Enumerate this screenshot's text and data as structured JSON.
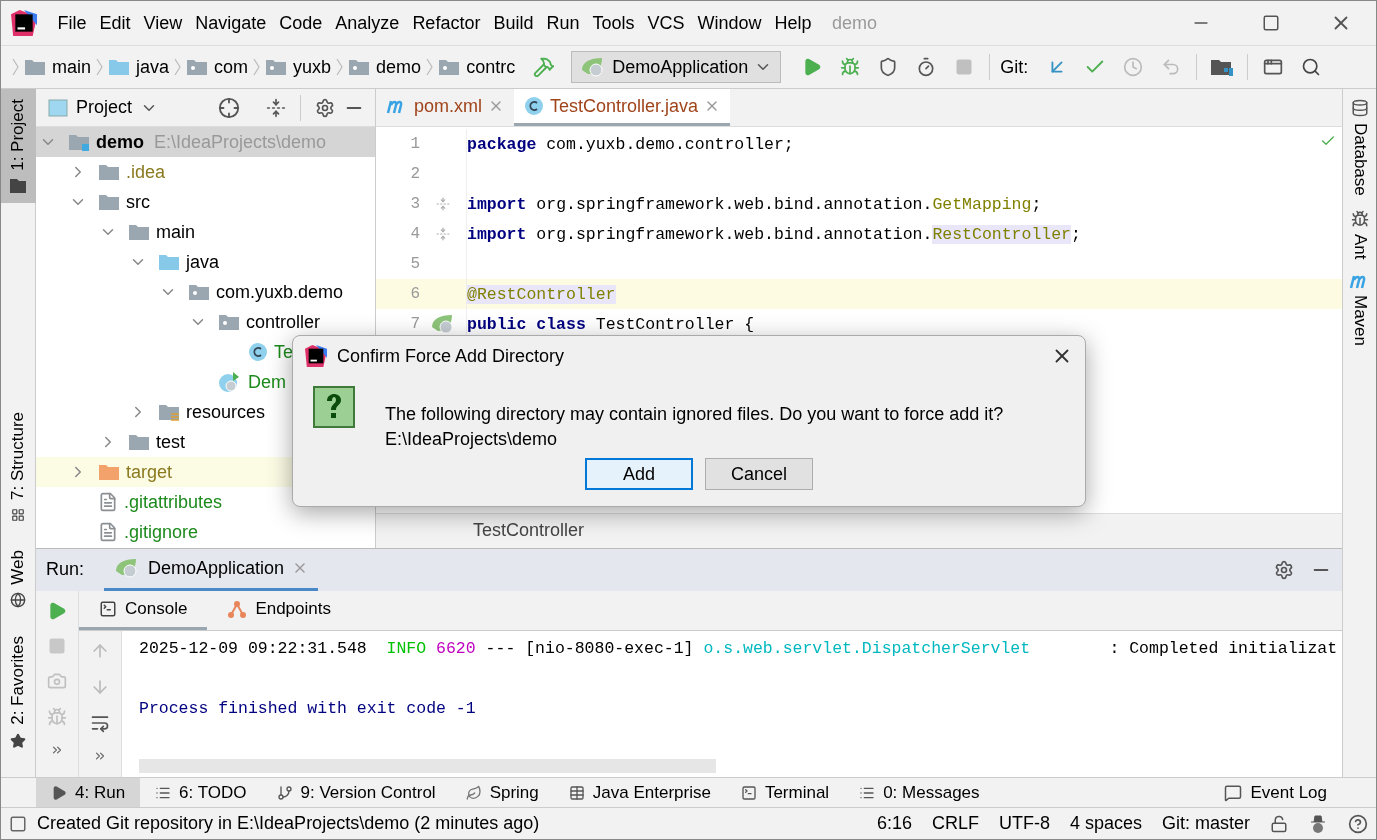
{
  "menu": {
    "items": [
      "File",
      "Edit",
      "View",
      "Navigate",
      "Code",
      "Analyze",
      "Refactor",
      "Build",
      "Run",
      "Tools",
      "VCS",
      "Window",
      "Help"
    ],
    "project_title": "demo"
  },
  "navbar": {
    "breadcrumbs": [
      {
        "label": "main",
        "kind": "folder"
      },
      {
        "label": "java",
        "kind": "source-folder"
      },
      {
        "label": "com",
        "kind": "package"
      },
      {
        "label": "yuxb",
        "kind": "package"
      },
      {
        "label": "demo",
        "kind": "package"
      },
      {
        "label": "contrc",
        "kind": "package"
      }
    ],
    "run_config": "DemoApplication",
    "git_label": "Git:"
  },
  "left_stripe": {
    "top": [
      {
        "label": "1: Project",
        "kind": "project",
        "selected": true
      }
    ],
    "bottom": [
      {
        "label": "7: Structure",
        "kind": "structure",
        "selected": false
      },
      {
        "label": "Web",
        "kind": "web",
        "selected": false
      },
      {
        "label": "2: Favorites",
        "kind": "favorites",
        "selected": false
      }
    ]
  },
  "project_panel": {
    "title": "Project",
    "tree": [
      {
        "label": "demo",
        "path": "E:\\IdeaProjects\\demo",
        "kind": "module",
        "color": "#000000",
        "expanded": true,
        "selected": true,
        "highlighted": false,
        "children": [
          {
            "label": ".idea",
            "kind": "folder",
            "color": "#8a7a1f",
            "expanded": false,
            "selected": false,
            "highlighted": false
          },
          {
            "label": "src",
            "kind": "folder",
            "color": "#000000",
            "expanded": true,
            "selected": false,
            "highlighted": false,
            "children": [
              {
                "label": "main",
                "kind": "folder",
                "color": "#000000",
                "expanded": true,
                "selected": false,
                "highlighted": false,
                "children": [
                  {
                    "label": "java",
                    "kind": "source-folder",
                    "color": "#000000",
                    "expanded": true,
                    "selected": false,
                    "highlighted": false,
                    "children": [
                      {
                        "label": "com.yuxb.demo",
                        "kind": "package",
                        "color": "#000000",
                        "expanded": true,
                        "selected": false,
                        "highlighted": false,
                        "children": [
                          {
                            "label": "controller",
                            "kind": "package",
                            "color": "#000000",
                            "expanded": true,
                            "selected": false,
                            "highlighted": false,
                            "children": [
                              {
                                "label": "Te",
                                "kind": "class",
                                "color": "#1c8a1c",
                                "selected": false,
                                "highlighted": false
                              }
                            ]
                          },
                          {
                            "label": "Dem",
                            "kind": "app",
                            "color": "#1c8a1c",
                            "selected": false,
                            "highlighted": false
                          }
                        ]
                      }
                    ]
                  },
                  {
                    "label": "resources",
                    "kind": "resources",
                    "color": "#000000",
                    "expanded": false,
                    "selected": false,
                    "highlighted": false
                  }
                ]
              },
              {
                "label": "test",
                "kind": "folder",
                "color": "#000000",
                "expanded": false,
                "selected": false,
                "highlighted": false
              }
            ]
          },
          {
            "label": "target",
            "kind": "excluded",
            "color": "#8a7a1f",
            "expanded": false,
            "selected": false,
            "highlighted": true
          },
          {
            "label": ".gitattributes",
            "kind": "file",
            "color": "#1c8a1c",
            "selected": false,
            "highlighted": false
          },
          {
            "label": ".gitignore",
            "kind": "ignore-file",
            "color": "#1c8a1c",
            "selected": false,
            "highlighted": false
          }
        ]
      }
    ]
  },
  "editor": {
    "tabs": [
      {
        "label": "pom.xml",
        "kind": "maven",
        "selected": false
      },
      {
        "label": "TestController.java",
        "kind": "class",
        "selected": true
      }
    ],
    "lines": [
      {
        "number": "1",
        "current": false,
        "tokens": [
          {
            "kind": "keyword",
            "text": "package"
          },
          {
            "kind": "plain",
            "text": " com.yuxb.demo.controller;"
          }
        ]
      },
      {
        "number": "2",
        "current": false
      },
      {
        "number": "3",
        "current": false,
        "gutter_icon": {
          "kind": "fold-start"
        },
        "tokens": [
          {
            "kind": "keyword",
            "text": "import"
          },
          {
            "kind": "plain",
            "text": " org.springframework.web.bind.annotation."
          },
          {
            "kind": "annotation",
            "text": "GetMapping"
          },
          {
            "kind": "plain",
            "text": ";"
          }
        ]
      },
      {
        "number": "4",
        "current": false,
        "gutter_icon": {
          "kind": "fold-end"
        },
        "tokens": [
          {
            "kind": "keyword",
            "text": "import"
          },
          {
            "kind": "plain",
            "text": " org.springframework.web.bind.annotation."
          },
          {
            "kind": "marked",
            "text": "RestController"
          },
          {
            "kind": "plain",
            "text": ";"
          }
        ]
      },
      {
        "number": "5",
        "current": false
      },
      {
        "number": "6",
        "current": true,
        "tokens": [
          {
            "kind": "marked",
            "text": "@RestController"
          }
        ]
      },
      {
        "number": "7",
        "current": false,
        "gutter_icon": {
          "kind": "bean"
        },
        "tokens": [
          {
            "kind": "keyword",
            "text": "public class"
          },
          {
            "kind": "plain",
            "text": " TestController {"
          }
        ]
      }
    ],
    "breadcrumb": "TestController"
  },
  "right_stripe": [
    {
      "label": "Database",
      "kind": "database"
    },
    {
      "label": "Ant",
      "kind": "ant"
    },
    {
      "label": "Maven",
      "kind": "maven"
    }
  ],
  "run_panel": {
    "label": "Run:",
    "tabs": [
      {
        "label": "DemoApplication",
        "selected": true
      }
    ],
    "subtabs": [
      {
        "label": "Console",
        "kind": "console",
        "selected": true
      },
      {
        "label": "Endpoints",
        "kind": "endpoints",
        "selected": false
      }
    ],
    "log": [
      {
        "kind": "plain",
        "text": "2025-12-09 09:22:31.548  "
      },
      {
        "kind": "info",
        "text": "INFO"
      },
      {
        "kind": "pid",
        "text": " 6620"
      },
      {
        "kind": "plain",
        "text": " --- [nio-8080-exec-1] "
      },
      {
        "kind": "logger",
        "text": "o.s.web.servlet.DispatcherServlet"
      },
      {
        "kind": "plain",
        "text": "        : Completed initializat"
      }
    ],
    "exit_message": "Process finished with exit code -1"
  },
  "tool_windows": [
    {
      "label": "4: Run",
      "kind": "run",
      "selected": true
    },
    {
      "label": "6: TODO",
      "kind": "todo",
      "selected": false
    },
    {
      "label": "9: Version Control",
      "kind": "vcs",
      "selected": false
    },
    {
      "label": "Spring",
      "kind": "spring",
      "selected": false
    },
    {
      "label": "Java Enterprise",
      "kind": "enterprise",
      "selected": false
    },
    {
      "label": "Terminal",
      "kind": "terminal",
      "selected": false
    },
    {
      "label": "0: Messages",
      "kind": "messages",
      "selected": false
    }
  ],
  "event_log": "Event Log",
  "status_bar": {
    "message": "Created Git repository in E:\\IdeaProjects\\demo (2 minutes ago)",
    "items": [
      "6:16",
      "CRLF",
      "UTF-8",
      "4 spaces",
      "Git: master"
    ]
  },
  "dialog": {
    "title": "Confirm Force Add Directory",
    "message": "The following directory may contain ignored files. Do you want to force add it?",
    "path": "E:\\IdeaProjects\\demo",
    "buttons": [
      {
        "label": "Add",
        "selected": true
      },
      {
        "label": "Cancel",
        "selected": false
      }
    ]
  }
}
